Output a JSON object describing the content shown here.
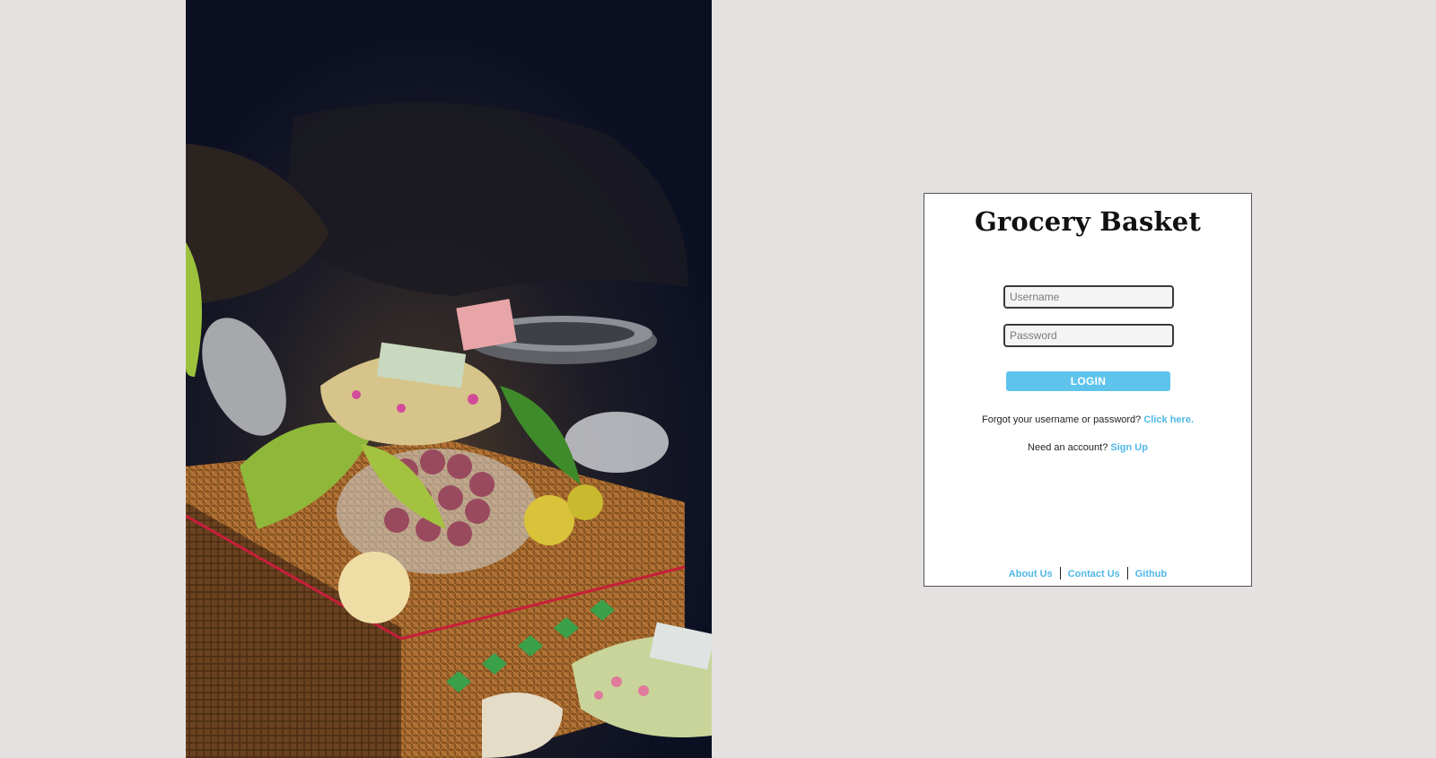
{
  "hero": {
    "image": "woven-basket-of-fruit-offerings-photo"
  },
  "login": {
    "brand": "Grocery Basket",
    "username_placeholder": "Username",
    "password_placeholder": "Password",
    "login_label": "LOGIN",
    "forgot_text": "Forgot your username or password?",
    "forgot_link": "Click here.",
    "signup_text": "Need an account?",
    "signup_link": "Sign Up"
  },
  "footer": {
    "about": "About Us",
    "contact": "Contact Us",
    "github": "Github"
  },
  "colors": {
    "page_background": "#e5e1e1",
    "accent": "#5ec4ec",
    "link": "#4fb8e6"
  }
}
